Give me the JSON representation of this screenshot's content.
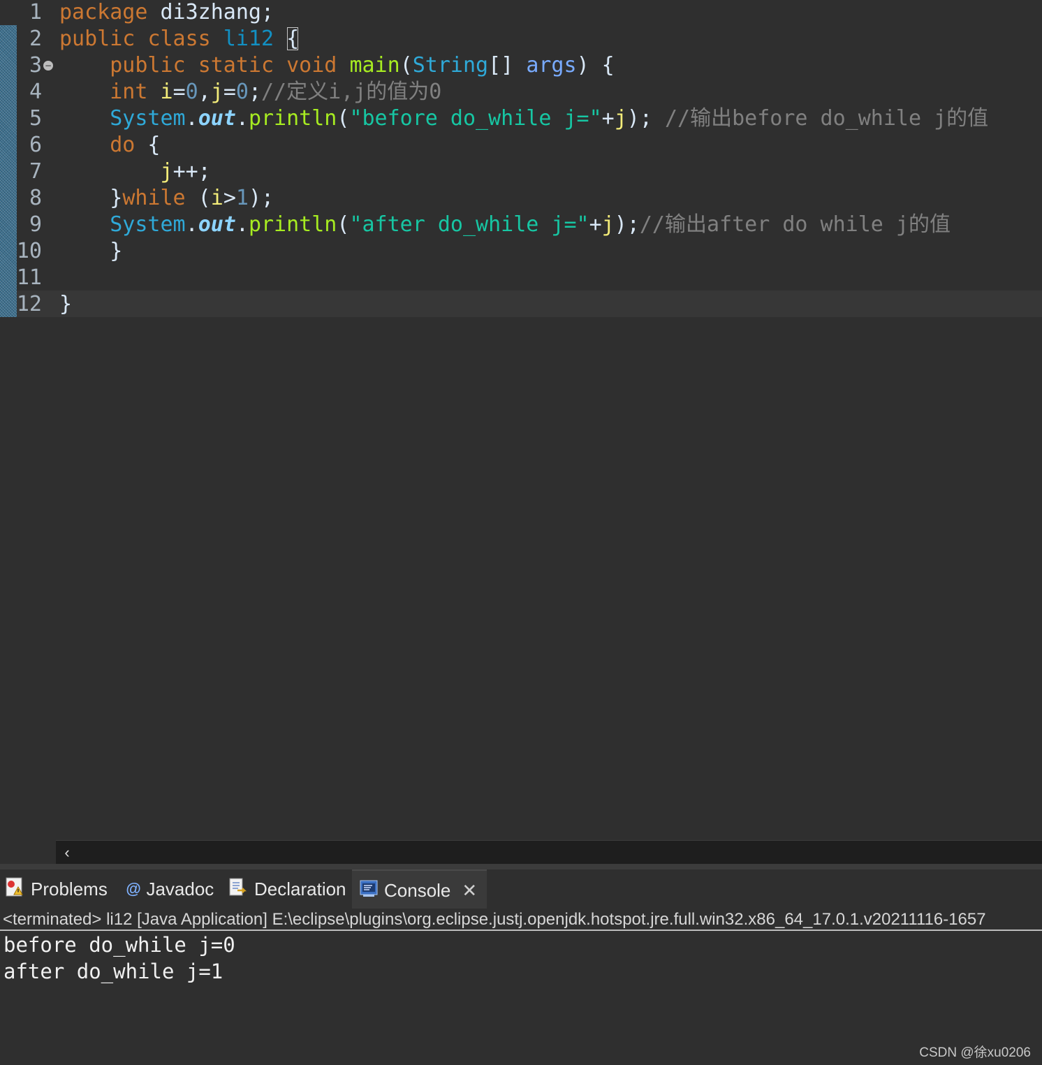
{
  "editor": {
    "line_numbers": [
      "1",
      "2",
      "3",
      "4",
      "5",
      "6",
      "7",
      "8",
      "9",
      "10",
      "11",
      "12"
    ],
    "lines": [
      [
        {
          "t": "package",
          "c": "kw"
        },
        {
          "t": " di3zhang;",
          "c": "pl"
        }
      ],
      [
        {
          "t": "public",
          "c": "kw"
        },
        {
          "t": " ",
          "c": "pl"
        },
        {
          "t": "class",
          "c": "kw"
        },
        {
          "t": " ",
          "c": "pl"
        },
        {
          "t": "li12",
          "c": "cls"
        },
        {
          "t": " ",
          "c": "pl"
        },
        {
          "t": "{",
          "c": "pl brace-box"
        }
      ],
      [
        {
          "t": "    ",
          "c": "pl"
        },
        {
          "t": "public",
          "c": "kw"
        },
        {
          "t": " ",
          "c": "pl"
        },
        {
          "t": "static",
          "c": "kw"
        },
        {
          "t": " ",
          "c": "pl"
        },
        {
          "t": "void",
          "c": "kw"
        },
        {
          "t": " ",
          "c": "pl"
        },
        {
          "t": "main",
          "c": "fn"
        },
        {
          "t": "(",
          "c": "pl"
        },
        {
          "t": "String",
          "c": "ty"
        },
        {
          "t": "[] ",
          "c": "pl"
        },
        {
          "t": "args",
          "c": "prm"
        },
        {
          "t": ") {",
          "c": "pl"
        }
      ],
      [
        {
          "t": "    ",
          "c": "pl"
        },
        {
          "t": "int",
          "c": "kw"
        },
        {
          "t": " ",
          "c": "pl"
        },
        {
          "t": "i",
          "c": "var"
        },
        {
          "t": "=",
          "c": "pl"
        },
        {
          "t": "0",
          "c": "num"
        },
        {
          "t": ",",
          "c": "pl"
        },
        {
          "t": "j",
          "c": "var"
        },
        {
          "t": "=",
          "c": "pl"
        },
        {
          "t": "0",
          "c": "num"
        },
        {
          "t": ";",
          "c": "pl"
        },
        {
          "t": "//定义i,j的值为0",
          "c": "cmt"
        }
      ],
      [
        {
          "t": "    ",
          "c": "pl"
        },
        {
          "t": "System",
          "c": "ty"
        },
        {
          "t": ".",
          "c": "pl"
        },
        {
          "t": "out",
          "c": "outf"
        },
        {
          "t": ".",
          "c": "pl"
        },
        {
          "t": "println",
          "c": "fn"
        },
        {
          "t": "(",
          "c": "pl"
        },
        {
          "t": "\"before do_while j=\"",
          "c": "str"
        },
        {
          "t": "+",
          "c": "pl"
        },
        {
          "t": "j",
          "c": "var"
        },
        {
          "t": "); ",
          "c": "pl"
        },
        {
          "t": "//输出before do_while j的值",
          "c": "cmt"
        }
      ],
      [
        {
          "t": "    ",
          "c": "pl"
        },
        {
          "t": "do",
          "c": "kw"
        },
        {
          "t": " {",
          "c": "pl"
        }
      ],
      [
        {
          "t": "        ",
          "c": "pl"
        },
        {
          "t": "j",
          "c": "var"
        },
        {
          "t": "++;",
          "c": "pl"
        }
      ],
      [
        {
          "t": "    }",
          "c": "pl"
        },
        {
          "t": "while",
          "c": "kw"
        },
        {
          "t": " (",
          "c": "pl"
        },
        {
          "t": "i",
          "c": "var"
        },
        {
          "t": ">",
          "c": "pl"
        },
        {
          "t": "1",
          "c": "num"
        },
        {
          "t": ");",
          "c": "pl"
        }
      ],
      [
        {
          "t": "    ",
          "c": "pl"
        },
        {
          "t": "System",
          "c": "ty"
        },
        {
          "t": ".",
          "c": "pl"
        },
        {
          "t": "out",
          "c": "outf"
        },
        {
          "t": ".",
          "c": "pl"
        },
        {
          "t": "println",
          "c": "fn"
        },
        {
          "t": "(",
          "c": "pl"
        },
        {
          "t": "\"after do_while j=\"",
          "c": "str"
        },
        {
          "t": "+",
          "c": "pl"
        },
        {
          "t": "j",
          "c": "var"
        },
        {
          "t": ");",
          "c": "pl"
        },
        {
          "t": "//输出after do while j的值",
          "c": "cmt"
        }
      ],
      [
        {
          "t": "    }",
          "c": "pl"
        }
      ],
      [],
      [
        {
          "t": "}",
          "c": "pl"
        }
      ]
    ],
    "fold_marker": "−"
  },
  "scrollbar": {
    "left_arrow": "‹"
  },
  "tabs": [
    {
      "label": "Problems",
      "icon": "problems-icon"
    },
    {
      "label": "Javadoc",
      "icon": "javadoc-icon"
    },
    {
      "label": "Declaration",
      "icon": "declaration-icon"
    },
    {
      "label": "Console",
      "icon": "console-icon",
      "close": "✕"
    }
  ],
  "console": {
    "header": "<terminated> li12 [Java Application] E:\\eclipse\\plugins\\org.eclipse.justj.openjdk.hotspot.jre.full.win32.x86_64_17.0.1.v20211116-1657",
    "output": [
      "before do_while j=0",
      "after do_while j=1"
    ]
  },
  "watermark": "CSDN @徐xu0206",
  "colors": {
    "keyword": "#cc7832",
    "type": "#2fa9d8",
    "string": "#17c6a3",
    "method": "#a7ec21",
    "variable": "#f3ec79",
    "param": "#79abff",
    "number": "#6897bb",
    "comment": "#808080",
    "background": "#2f2f2f"
  }
}
